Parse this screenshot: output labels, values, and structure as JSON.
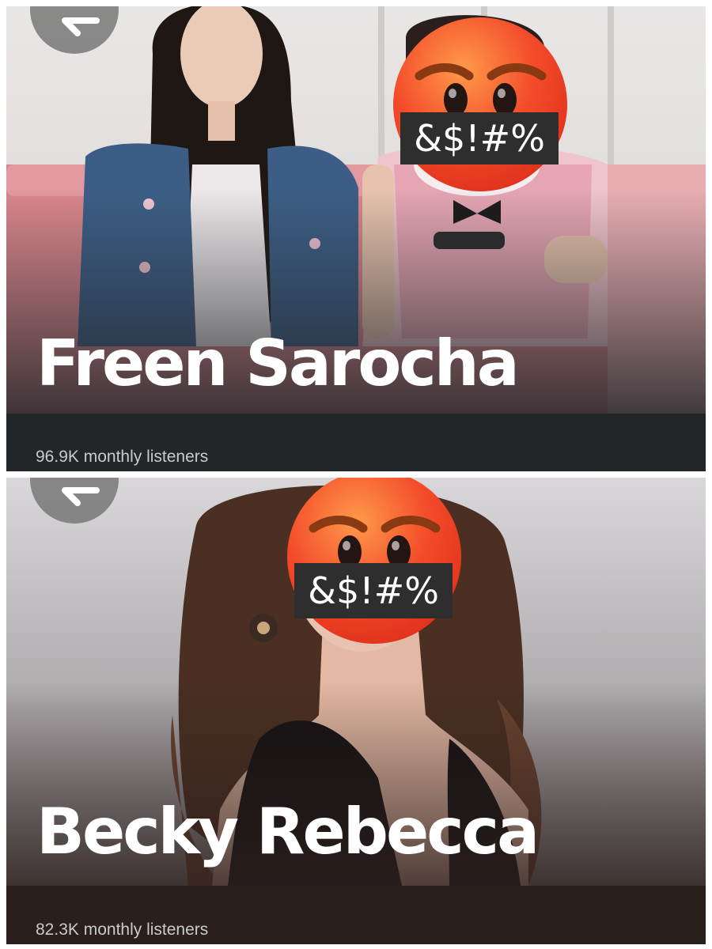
{
  "panels": [
    {
      "artist_name": "Freen Sarocha",
      "monthly_listeners": "96.9K monthly listeners",
      "censor_text": "&$!#%",
      "back_icon": "chevron-left-icon",
      "emoji_icon": "angry-face-icon",
      "bottom_bar_color": "#232629"
    },
    {
      "artist_name": "Becky Rebecca",
      "monthly_listeners": "82.3K monthly listeners",
      "censor_text": "&$!#%",
      "back_icon": "chevron-left-icon",
      "emoji_icon": "angry-face-icon",
      "bottom_bar_color": "#2b1f1d"
    }
  ]
}
